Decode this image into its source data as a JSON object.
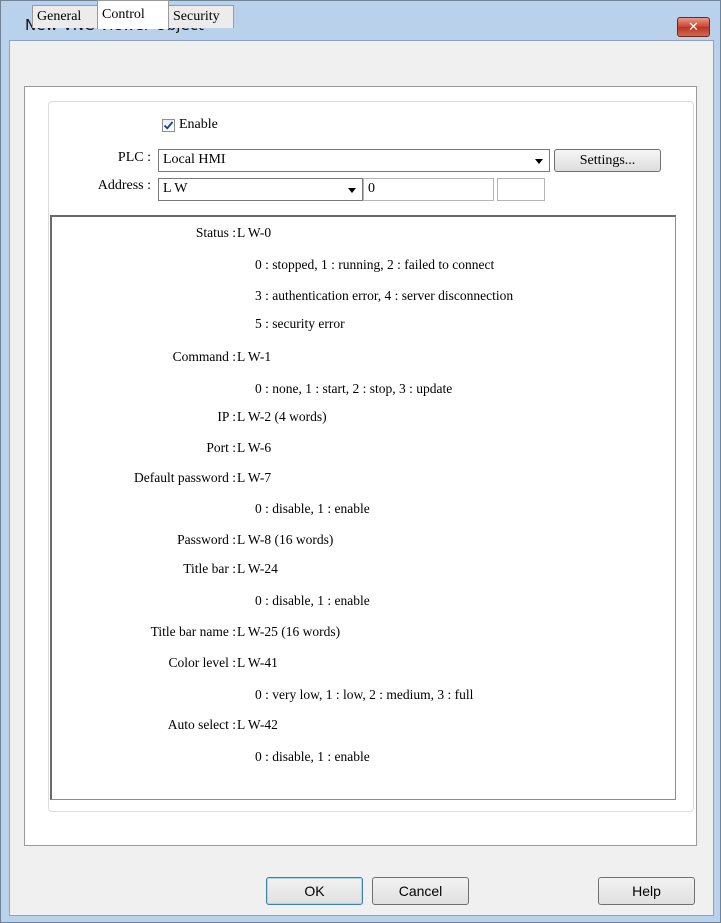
{
  "window": {
    "title": "New VNC Viewer Object",
    "close_symbol": "✕"
  },
  "tabs": [
    {
      "label": "General"
    },
    {
      "label": "Control"
    },
    {
      "label": "Security"
    }
  ],
  "control": {
    "enable_label": "Enable",
    "enable_checked": true,
    "plc_label": "PLC :",
    "plc_value": "Local HMI",
    "settings_label": "Settings...",
    "address_label": "Address :",
    "address_type": "L W",
    "address_value": "0",
    "address_extra": ""
  },
  "info": [
    {
      "key": "Status :",
      "value": "L W-0"
    },
    {
      "key": "",
      "value": "0 : stopped, 1 : running, 2 : failed to connect"
    },
    {
      "key": "",
      "value": "3 : authentication error, 4 : server disconnection"
    },
    {
      "key": "",
      "value": "5 : security error"
    },
    {
      "key": "Command :",
      "value": "L W-1"
    },
    {
      "key": "",
      "value": "0 : none, 1 : start, 2 : stop, 3 : update"
    },
    {
      "key": "IP :",
      "value": "L W-2 (4 words)"
    },
    {
      "key": "Port :",
      "value": "L W-6"
    },
    {
      "key": "Default password :",
      "value": "L W-7"
    },
    {
      "key": "",
      "value": "0 : disable, 1 : enable"
    },
    {
      "key": "Password :",
      "value": "L W-8 (16 words)"
    },
    {
      "key": "Title bar :",
      "value": "L W-24"
    },
    {
      "key": "",
      "value": "0 : disable, 1 : enable"
    },
    {
      "key": "Title bar name :",
      "value": "L W-25 (16 words)"
    },
    {
      "key": "Color level :",
      "value": "L W-41"
    },
    {
      "key": "",
      "value": "0 : very low, 1 : low, 2 : medium, 3 : full"
    },
    {
      "key": "Auto select :",
      "value": "L W-42"
    },
    {
      "key": "",
      "value": "0 : disable, 1 : enable"
    }
  ],
  "footer": {
    "ok_label": "OK",
    "cancel_label": "Cancel",
    "help_label": "Help"
  }
}
